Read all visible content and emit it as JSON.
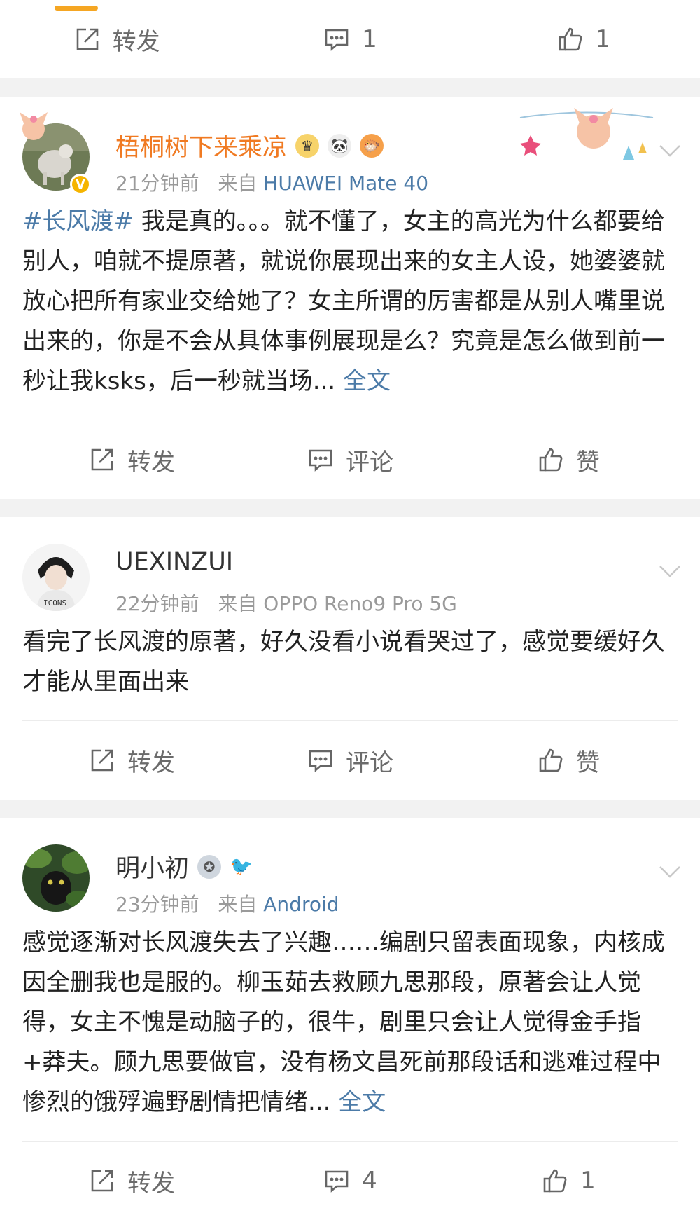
{
  "top_actions": {
    "repost": "转发",
    "comments": "1",
    "likes": "1"
  },
  "posts": [
    {
      "name": "梧桐树下来乘凉",
      "time": "21分钟前",
      "from": "来自",
      "device": "HUAWEI Mate 40",
      "hashtag": "#长风渡#",
      "text": " 我是真的。。。就不懂了，女主的高光为什么都要给别人，咱就不提原著，就说你展现出来的女主人设，她婆婆就放心把所有家业交给她了？女主所谓的厉害都是从别人嘴里说出来的，你是不会从具体事例展现是么？究竟是怎么做到前一秒让我ksks，后一秒就当场...",
      "more": " 全文",
      "actions": {
        "repost": "转发",
        "comment": "评论",
        "like": "赞"
      }
    },
    {
      "name": "UEXINZUI",
      "time": "22分钟前",
      "from": "来自",
      "device": "OPPO Reno9 Pro 5G",
      "text": "看完了长风渡的原著，好久没看小说看哭过了，感觉要缓好久才能从里面出来",
      "actions": {
        "repost": "转发",
        "comment": "评论",
        "like": "赞"
      }
    },
    {
      "name": "明小初",
      "time": "23分钟前",
      "from": "来自",
      "device": "Android",
      "text": "感觉逐渐对长风渡失去了兴趣……编剧只留表面现象，内核成因全删我也是服的。柳玉茹去救顾九思那段，原著会让人觉得，女主不愧是动脑子的，很牛，剧里只会让人觉得金手指+莽夫。顾九思要做官，没有杨文昌死前那段话和逃难过程中惨烈的饿殍遍野剧情把情绪...",
      "more": " 全文",
      "actions": {
        "repost": "转发",
        "comment": "4",
        "like": "1"
      }
    }
  ],
  "colors": {
    "link": "#4c7ba8",
    "vip_name": "#f07a22",
    "meta": "#9a9a9a",
    "action": "#6b6b6b"
  }
}
